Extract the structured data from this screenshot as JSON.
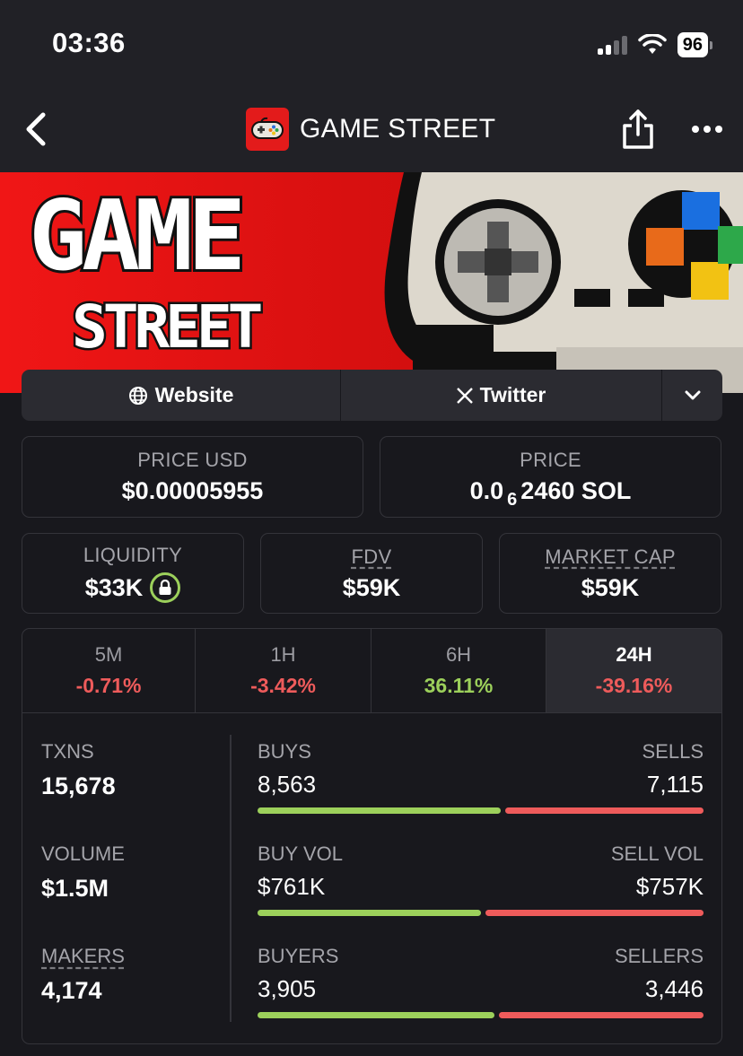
{
  "status_bar": {
    "time": "03:36",
    "battery": "96"
  },
  "nav": {
    "title": "GAME STREET"
  },
  "banner": {
    "line1": "GAME",
    "line2": "STREET"
  },
  "links": {
    "website": "Website",
    "twitter": "Twitter"
  },
  "price_usd": {
    "label": "PRICE USD",
    "value": "$0.00005955"
  },
  "price_sol": {
    "label": "PRICE",
    "prefix": "0.0",
    "zeros": "6",
    "digits": "2460 SOL"
  },
  "liquidity": {
    "label": "LIQUIDITY",
    "value": "$33K"
  },
  "fdv": {
    "label": "FDV",
    "value": "$59K"
  },
  "market_cap": {
    "label": "MARKET CAP",
    "value": "$59K"
  },
  "timeframes": [
    {
      "label": "5M",
      "change": "-0.71%"
    },
    {
      "label": "1H",
      "change": "-3.42%"
    },
    {
      "label": "6H",
      "change": "36.11%"
    },
    {
      "label": "24H",
      "change": "-39.16%"
    }
  ],
  "stats": {
    "txns": {
      "label": "TXNS",
      "value": "15,678"
    },
    "volume": {
      "label": "VOLUME",
      "value": "$1.5M"
    },
    "makers": {
      "label": "MAKERS",
      "value": "4,174"
    },
    "buys": {
      "label": "BUYS",
      "value": "8,563",
      "sell_label": "SELLS",
      "sell_value": "7,115",
      "buy_fraction": 0.546
    },
    "buy_vol": {
      "label": "BUY VOL",
      "value": "$761K",
      "sell_label": "SELL VOL",
      "sell_value": "$757K",
      "buy_fraction": 0.501
    },
    "buyers": {
      "label": "BUYERS",
      "value": "3,905",
      "sell_label": "SELLERS",
      "sell_value": "3,446",
      "buy_fraction": 0.531
    }
  },
  "colors": {
    "positive": "#9cd05b",
    "negative": "#ee5b5b",
    "brand_red": "#e31b1b"
  },
  "icons": [
    "back-chevron-icon",
    "gamepad-logo-icon",
    "share-icon",
    "more-dots-icon",
    "globe-icon",
    "x-logo-icon",
    "chevron-down-icon",
    "lock-icon"
  ]
}
